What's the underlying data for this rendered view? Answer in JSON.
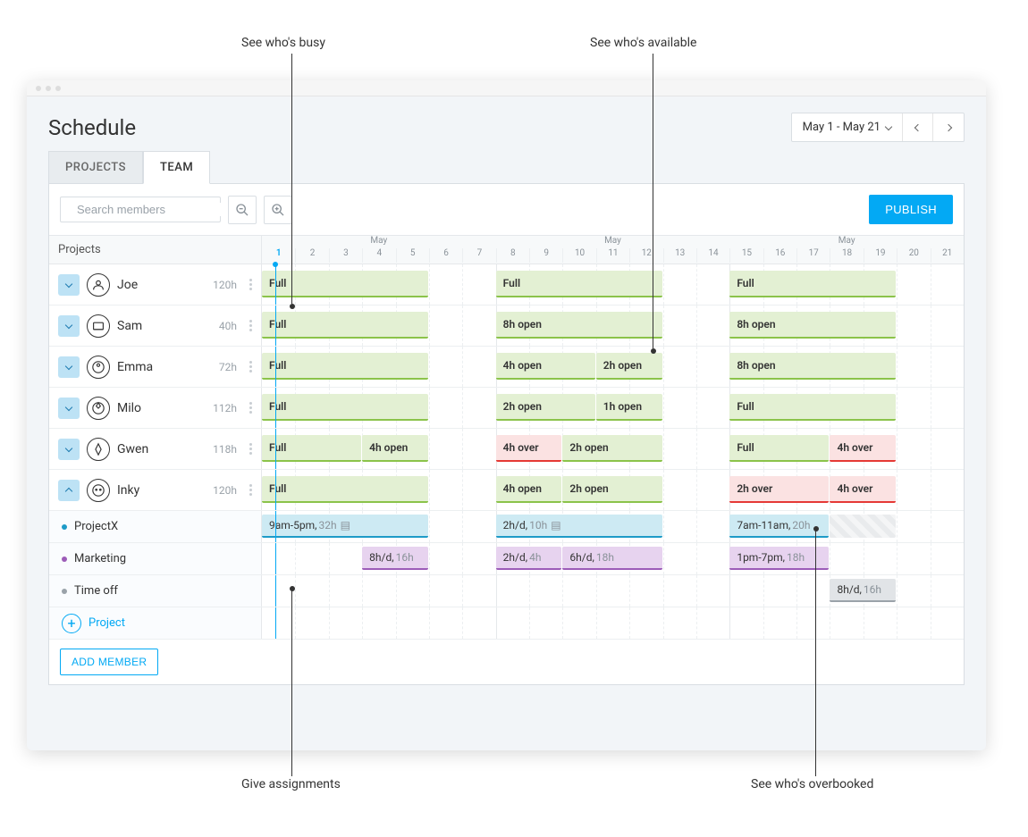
{
  "annotations": {
    "busy": "See who's busy",
    "available": "See who's available",
    "assignments": "Give assignments",
    "overbooked": "See who's overbooked"
  },
  "header": {
    "title": "Schedule",
    "date_range": "May 1 - May 21"
  },
  "tabs": {
    "projects": "PROJECTS",
    "team": "TEAM"
  },
  "toolbar": {
    "search_placeholder": "Search members",
    "publish": "PUBLISH"
  },
  "grid": {
    "projects_header": "Projects",
    "month_label": "May",
    "days": [
      1,
      2,
      3,
      4,
      5,
      6,
      7,
      8,
      9,
      10,
      11,
      12,
      13,
      14,
      15,
      16,
      17,
      18,
      19,
      20,
      21
    ],
    "weekend_indices": [
      5,
      6,
      12,
      13,
      19,
      20
    ],
    "today_index": 0
  },
  "members": [
    {
      "name": "Joe",
      "hours": "120h",
      "expanded": false,
      "blocks": [
        {
          "start": 0,
          "span": 5,
          "label": "Full",
          "color": "green"
        },
        {
          "start": 7,
          "span": 5,
          "label": "Full",
          "color": "green"
        },
        {
          "start": 14,
          "span": 5,
          "label": "Full",
          "color": "green"
        }
      ]
    },
    {
      "name": "Sam",
      "hours": "40h",
      "expanded": false,
      "blocks": [
        {
          "start": 0,
          "span": 5,
          "label": "Full",
          "color": "green"
        },
        {
          "start": 7,
          "span": 5,
          "label": "8h open",
          "color": "green"
        },
        {
          "start": 14,
          "span": 5,
          "label": "8h open",
          "color": "green"
        }
      ]
    },
    {
      "name": "Emma",
      "hours": "72h",
      "expanded": false,
      "blocks": [
        {
          "start": 0,
          "span": 5,
          "label": "Full",
          "color": "green"
        },
        {
          "start": 7,
          "span": 3,
          "label": "4h open",
          "color": "green"
        },
        {
          "start": 10,
          "span": 2,
          "label": "2h open",
          "color": "green"
        },
        {
          "start": 14,
          "span": 5,
          "label": "8h open",
          "color": "green"
        }
      ]
    },
    {
      "name": "Milo",
      "hours": "112h",
      "expanded": false,
      "blocks": [
        {
          "start": 0,
          "span": 5,
          "label": "Full",
          "color": "green"
        },
        {
          "start": 7,
          "span": 3,
          "label": "2h open",
          "color": "green"
        },
        {
          "start": 10,
          "span": 2,
          "label": "1h open",
          "color": "green"
        },
        {
          "start": 14,
          "span": 5,
          "label": "Full",
          "color": "green"
        }
      ]
    },
    {
      "name": "Gwen",
      "hours": "118h",
      "expanded": false,
      "blocks": [
        {
          "start": 0,
          "span": 3,
          "label": "Full",
          "color": "green"
        },
        {
          "start": 3,
          "span": 2,
          "label": "4h open",
          "color": "green"
        },
        {
          "start": 7,
          "span": 2,
          "label": "4h over",
          "color": "red"
        },
        {
          "start": 9,
          "span": 3,
          "label": "2h open",
          "color": "green"
        },
        {
          "start": 14,
          "span": 3,
          "label": "Full",
          "color": "green"
        },
        {
          "start": 17,
          "span": 2,
          "label": "4h over",
          "color": "red"
        }
      ]
    },
    {
      "name": "Inky",
      "hours": "120h",
      "expanded": true,
      "blocks": [
        {
          "start": 0,
          "span": 5,
          "label": "Full",
          "color": "green"
        },
        {
          "start": 7,
          "span": 2,
          "label": "4h open",
          "color": "green"
        },
        {
          "start": 9,
          "span": 3,
          "label": "2h open",
          "color": "green"
        },
        {
          "start": 14,
          "span": 3,
          "label": "2h over",
          "color": "red"
        },
        {
          "start": 17,
          "span": 2,
          "label": "4h over",
          "color": "red"
        }
      ],
      "projects": [
        {
          "name": "ProjectX",
          "dot": "#1e9bc7",
          "blocks": [
            {
              "start": 0,
              "span": 5,
              "label": "9am-5pm,",
              "suffix": "32h",
              "color": "cyan",
              "note": true
            },
            {
              "start": 7,
              "span": 5,
              "label": "2h/d,",
              "suffix": "10h",
              "color": "cyan",
              "note": true
            },
            {
              "start": 14,
              "span": 3,
              "label": "7am-11am,",
              "suffix": "20h",
              "color": "cyan"
            },
            {
              "start": 17,
              "span": 2,
              "label": "",
              "color": "hatch"
            }
          ]
        },
        {
          "name": "Marketing",
          "dot": "#9c5cb8",
          "blocks": [
            {
              "start": 3,
              "span": 2,
              "label": "8h/d,",
              "suffix": "16h",
              "color": "purple"
            },
            {
              "start": 7,
              "span": 2,
              "label": "2h/d,",
              "suffix": "4h",
              "color": "purple"
            },
            {
              "start": 9,
              "span": 3,
              "label": "6h/d,",
              "suffix": "18h",
              "color": "purple"
            },
            {
              "start": 14,
              "span": 3,
              "label": "1pm-7pm,",
              "suffix": "18h",
              "color": "purple"
            }
          ]
        },
        {
          "name": "Time off",
          "dot": "#9aa2a9",
          "blocks": [
            {
              "start": 17,
              "span": 2,
              "label": "8h/d,",
              "suffix": "16h",
              "color": "grey"
            }
          ]
        }
      ]
    }
  ],
  "add_project_label": "Project",
  "add_member": "ADD MEMBER"
}
